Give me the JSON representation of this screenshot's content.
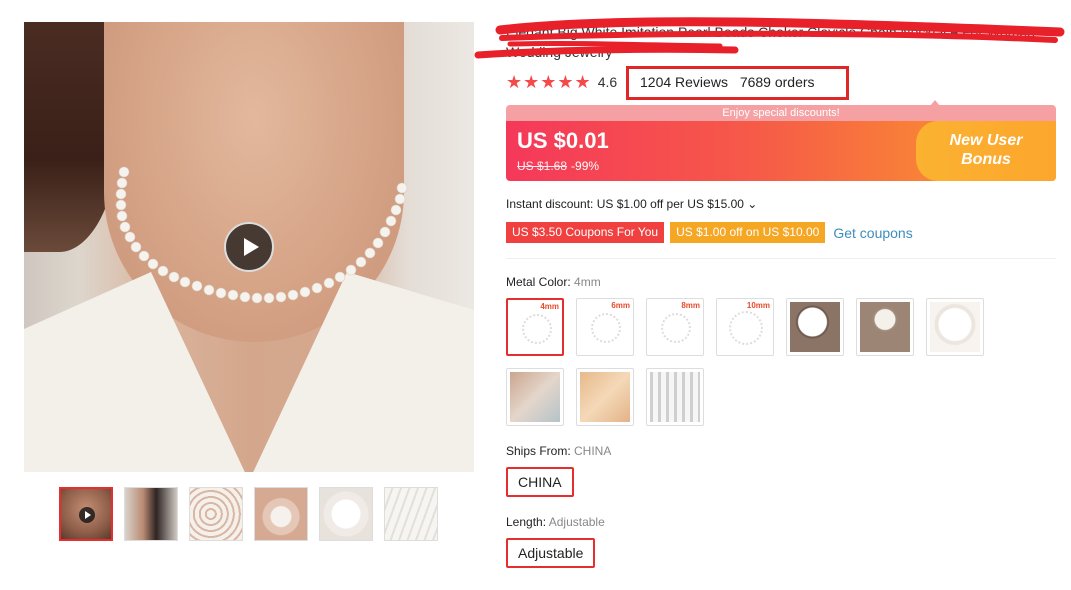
{
  "product": {
    "title": "Elegant Big White Imitation Pearl Beads Choker Clavicle Chain Necklace For Women Wedding Jewelry"
  },
  "rating": {
    "stars": "★★★★★",
    "value": "4.6",
    "reviews": "1204 Reviews",
    "orders": "7689 orders"
  },
  "promo": {
    "banner": "Enjoy special discounts!",
    "price": "US $0.01",
    "original_price": "US $1.68",
    "discount": "-99%",
    "bonus_line1": "New User",
    "bonus_line2": "Bonus"
  },
  "discount": {
    "instant": "Instant discount: US $1.00 off per US $15.00 ⌄",
    "coupon1": "US $3.50 Coupons For You",
    "coupon2": "US $1.00 off on US $10.00",
    "get_coupons": "Get coupons"
  },
  "metal_color": {
    "label": "Metal Color: ",
    "value": "4mm",
    "options": [
      "4mm",
      "6mm",
      "8mm",
      "10mm"
    ]
  },
  "ships_from": {
    "label": "Ships From: ",
    "value": "CHINA",
    "option": "CHINA"
  },
  "length": {
    "label": "Length: ",
    "value": "Adjustable",
    "option": "Adjustable"
  },
  "colors": {
    "accent": "#e62e2e",
    "promo_start": "#f5385a",
    "promo_end": "#fba02b",
    "link": "#3d8dbb"
  }
}
